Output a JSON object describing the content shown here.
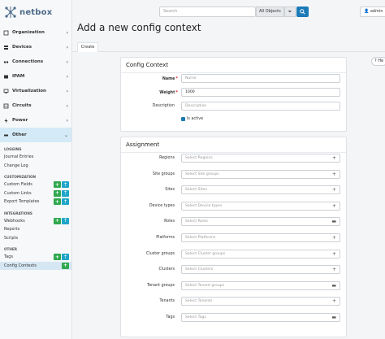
{
  "brand": {
    "name": "netbox"
  },
  "nav": [
    {
      "label": "Organization",
      "icon": "organization-icon",
      "active": false
    },
    {
      "label": "Devices",
      "icon": "server-icon",
      "active": false
    },
    {
      "label": "Connections",
      "icon": "connections-icon",
      "active": false
    },
    {
      "label": "IPAM",
      "icon": "ipam-icon",
      "active": false
    },
    {
      "label": "Virtualization",
      "icon": "monitor-icon",
      "active": false
    },
    {
      "label": "Circuits",
      "icon": "circuits-icon",
      "active": false
    },
    {
      "label": "Power",
      "icon": "power-icon",
      "active": false
    },
    {
      "label": "Other",
      "icon": "other-icon",
      "active": true
    }
  ],
  "submenu": {
    "logging": {
      "heading": "LOGGING",
      "items": [
        "Journal Entries",
        "Change Log"
      ]
    },
    "customization": {
      "heading": "CUSTOMIZATION",
      "items": [
        "Custom Fields",
        "Custom Links",
        "Export Templates"
      ]
    },
    "integrations": {
      "heading": "INTEGRATIONS",
      "items": [
        "Webhooks",
        "Reports",
        "Scripts"
      ]
    },
    "other": {
      "heading": "OTHER",
      "items": [
        "Tags",
        "Config Contexts"
      ]
    }
  },
  "topbar": {
    "search_placeholder": "Search",
    "object_select": "All Objects",
    "user": "admin"
  },
  "page": {
    "title": "Add a new config context",
    "tab": "Create",
    "help": "He"
  },
  "config_context": {
    "title": "Config Context",
    "name_label": "Name",
    "name_placeholder": "Name",
    "weight_label": "Weight",
    "weight_value": "1000",
    "description_label": "Description",
    "description_placeholder": "Description",
    "is_active_label": "Is active"
  },
  "assignment": {
    "title": "Assignment",
    "fields": [
      {
        "label": "Regions",
        "placeholder": "Select Regions"
      },
      {
        "label": "Site groups",
        "placeholder": "Select Site groups"
      },
      {
        "label": "Sites",
        "placeholder": "Select Sites"
      },
      {
        "label": "Device types",
        "placeholder": "Select Device types"
      },
      {
        "label": "Roles",
        "placeholder": "Select Roles"
      },
      {
        "label": "Platforms",
        "placeholder": "Select Platforms"
      },
      {
        "label": "Cluster groups",
        "placeholder": "Select Cluster groups"
      },
      {
        "label": "Clusters",
        "placeholder": "Select Clusters"
      },
      {
        "label": "Tenant groups",
        "placeholder": "Select Tenant groups"
      },
      {
        "label": "Tenants",
        "placeholder": "Select Tenants"
      },
      {
        "label": "Tags",
        "placeholder": "Select Tags"
      }
    ]
  },
  "colors": {
    "accent": "#1b7bb6",
    "green": "#2fa84f",
    "teal": "#1ea5c9",
    "active_bg": "#d4eaf7"
  }
}
